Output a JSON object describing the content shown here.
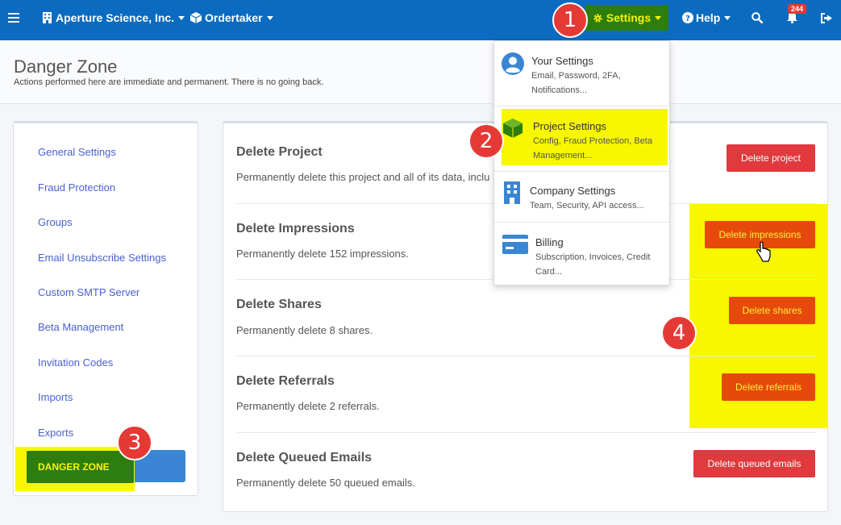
{
  "nav": {
    "org": "Aperture Science, Inc.",
    "project": "Ordertaker",
    "settings": "Settings",
    "help": "Help",
    "notifications_count": "244"
  },
  "header": {
    "title": "Danger Zone",
    "subtitle": "Actions performed here are immediate and permanent. There is no going back."
  },
  "sidebar": {
    "items": [
      {
        "label": "General Settings"
      },
      {
        "label": "Fraud Protection"
      },
      {
        "label": "Groups"
      },
      {
        "label": "Email Unsubscribe Settings"
      },
      {
        "label": "Custom SMTP Server"
      },
      {
        "label": "Beta Management"
      },
      {
        "label": "Invitation Codes"
      },
      {
        "label": "Imports"
      },
      {
        "label": "Exports"
      }
    ],
    "active": "DANGER ZONE"
  },
  "sections": [
    {
      "title": "Delete Project",
      "desc": "Permanently delete this project and all of its data, inclu",
      "button": "Delete project"
    },
    {
      "title": "Delete Impressions",
      "desc": "Permanently delete 152 impressions.",
      "button": "Delete impressions"
    },
    {
      "title": "Delete Shares",
      "desc": "Permanently delete 8 shares.",
      "button": "Delete shares"
    },
    {
      "title": "Delete Referrals",
      "desc": "Permanently delete 2 referrals.",
      "button": "Delete referrals"
    },
    {
      "title": "Delete Queued Emails",
      "desc": "Permanently delete 50 queued emails.",
      "button": "Delete queued emails"
    }
  ],
  "dropdown": {
    "items": [
      {
        "title": "Your Settings",
        "desc": "Email, Password, 2FA, Notifications..."
      },
      {
        "title": "Project Settings",
        "desc": "Config, Fraud Protection, Beta Management..."
      },
      {
        "title": "Company Settings",
        "desc": "Team, Security, API access..."
      },
      {
        "title": "Billing",
        "desc": "Subscription, Invoices, Credit Card..."
      }
    ]
  },
  "markers": [
    "1",
    "2",
    "3",
    "4"
  ],
  "colors": {
    "nav_bg": "#0a6bc0",
    "highlight_green": "#2e7d0f",
    "highlight_yellow": "#f7f700",
    "danger_red": "#e0393e",
    "marker_red": "#e53935"
  }
}
